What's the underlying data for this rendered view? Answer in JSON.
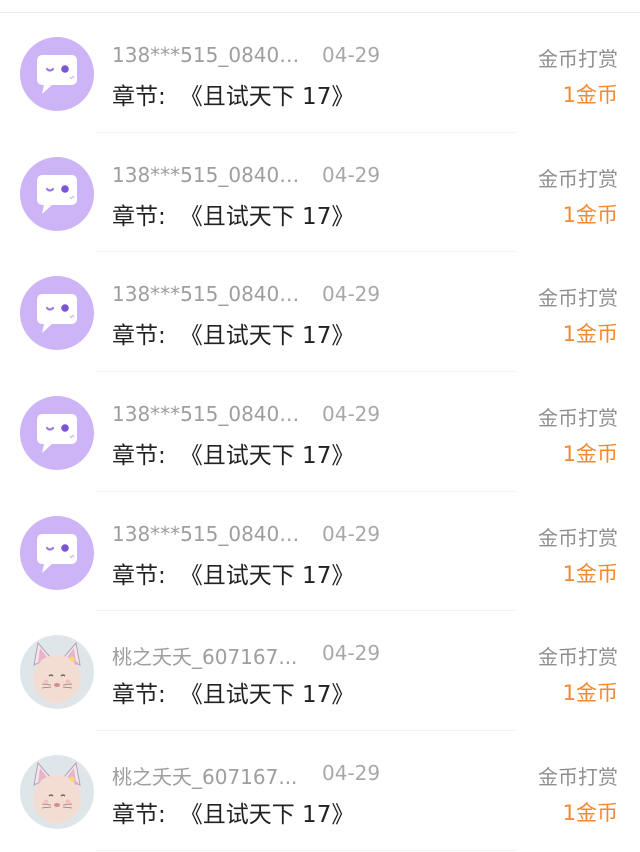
{
  "colors": {
    "accent": "#f28a2e",
    "avatar_purple": "#cdb4f6"
  },
  "records": [
    {
      "avatar": "chat-bubble-avatar",
      "name": "138***515_08404...",
      "date": "04-29",
      "chapter_label": "章节:",
      "book": "《且试天下 17》",
      "gift_type": "金币打赏",
      "amount": "1金币"
    },
    {
      "avatar": "chat-bubble-avatar",
      "name": "138***515_08404...",
      "date": "04-29",
      "chapter_label": "章节:",
      "book": "《且试天下 17》",
      "gift_type": "金币打赏",
      "amount": "1金币"
    },
    {
      "avatar": "chat-bubble-avatar",
      "name": "138***515_08404...",
      "date": "04-29",
      "chapter_label": "章节:",
      "book": "《且试天下 17》",
      "gift_type": "金币打赏",
      "amount": "1金币"
    },
    {
      "avatar": "chat-bubble-avatar",
      "name": "138***515_08404...",
      "date": "04-29",
      "chapter_label": "章节:",
      "book": "《且试天下 17》",
      "gift_type": "金币打赏",
      "amount": "1金币"
    },
    {
      "avatar": "chat-bubble-avatar",
      "name": "138***515_08404...",
      "date": "04-29",
      "chapter_label": "章节:",
      "book": "《且试天下 17》",
      "gift_type": "金币打赏",
      "amount": "1金币"
    },
    {
      "avatar": "cat-baby-photo-avatar",
      "name": "桃之夭夭_607167...",
      "date": "04-29",
      "chapter_label": "章节:",
      "book": "《且试天下 17》",
      "gift_type": "金币打赏",
      "amount": "1金币"
    },
    {
      "avatar": "cat-baby-photo-avatar",
      "name": "桃之夭夭_607167...",
      "date": "04-29",
      "chapter_label": "章节:",
      "book": "《且试天下 17》",
      "gift_type": "金币打赏",
      "amount": "1金币"
    }
  ]
}
